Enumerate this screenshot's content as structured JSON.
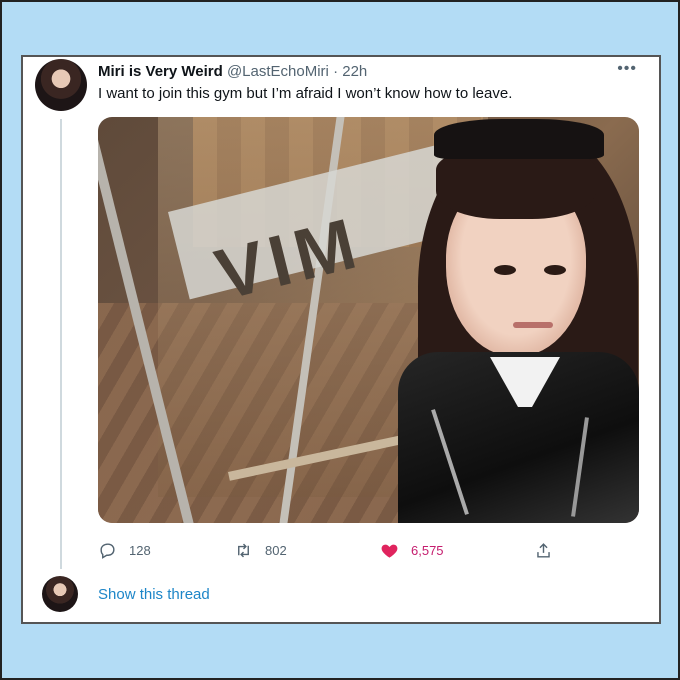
{
  "tweet": {
    "display_name": "Miri is Very Weird",
    "handle": "@LastEchoMiri",
    "separator": "·",
    "time": "22h",
    "more_icon": "more-icon",
    "text": "I want to join this gym but I’m afraid I won’t know how to leave.",
    "image_sign_text": "VIM"
  },
  "actions": {
    "replies": "128",
    "retweets": "802",
    "likes": "6,575",
    "like_color": "#e0245e"
  },
  "thread": {
    "show_label": "Show this thread"
  },
  "colors": {
    "background": "#b3dcf5",
    "link": "#1d86c8",
    "secondary_text": "#536471"
  }
}
